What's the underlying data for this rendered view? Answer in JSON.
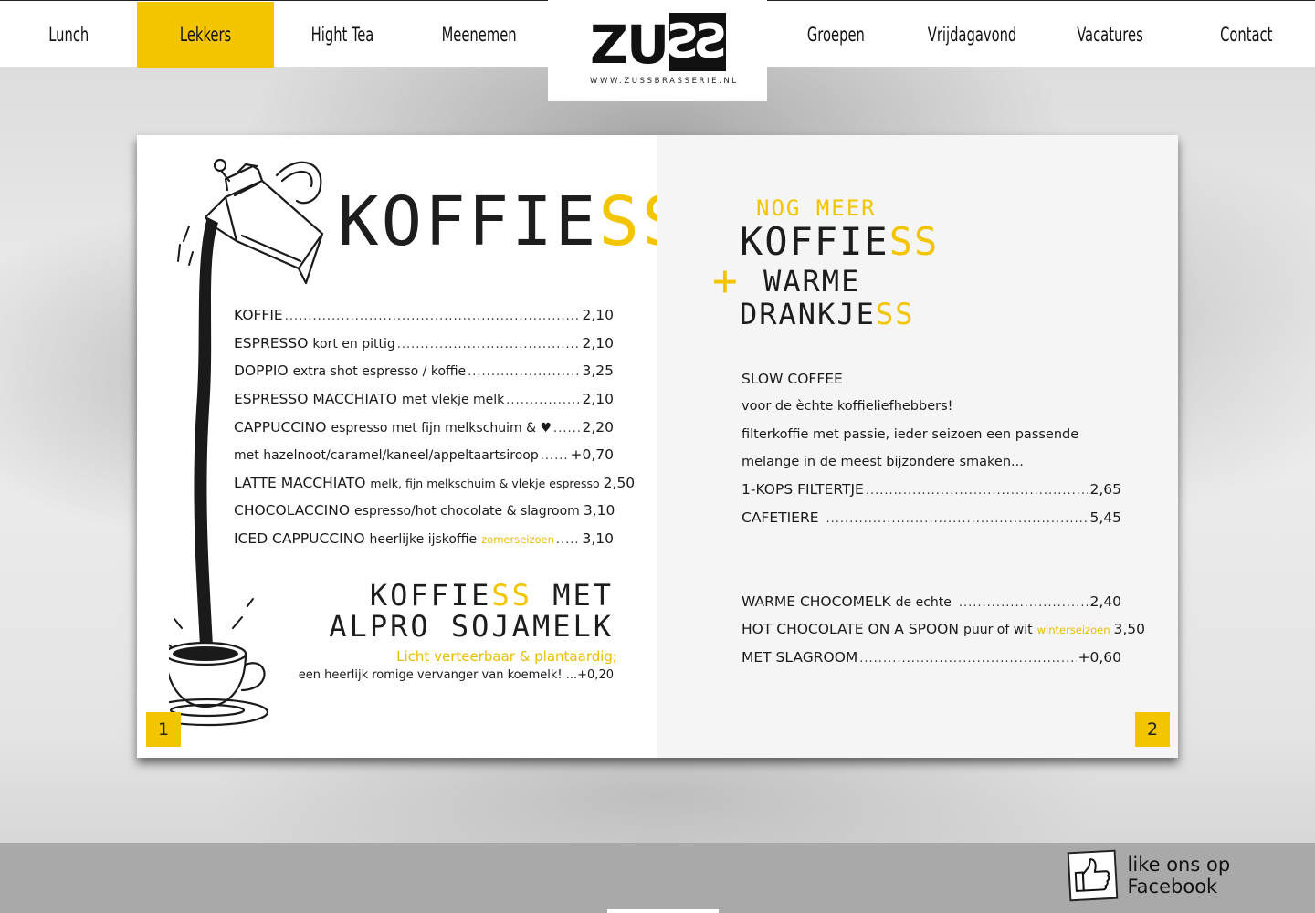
{
  "nav": {
    "items": [
      {
        "label": "Lunch",
        "active": false
      },
      {
        "label": "Lekkers",
        "active": true
      },
      {
        "label": "Hight Tea",
        "active": false
      },
      {
        "label": "Meenemen",
        "active": false
      },
      {
        "label": "Groepen",
        "active": false
      },
      {
        "label": "Vrijdagavond",
        "active": false
      },
      {
        "label": "Vacatures",
        "active": false
      },
      {
        "label": "Contact",
        "active": false
      }
    ],
    "accent_color": "#f2c500"
  },
  "logo": {
    "zu": "ZU",
    "ss": "SS",
    "url": "WWW.ZUSSBRASSERIE.NL"
  },
  "left_page": {
    "title_main": "KOFFIE",
    "title_ss": "SS",
    "items": [
      {
        "name": "KOFFIE",
        "desc": "",
        "note": "",
        "price": "2,10"
      },
      {
        "name": "ESPRESSO",
        "desc": "kort en pittig",
        "note": "",
        "price": "2,10"
      },
      {
        "name": "DOPPIO",
        "desc": "extra shot espresso / koffie",
        "note": "",
        "price": "3,25"
      },
      {
        "name": "ESPRESSO MACCHIATO",
        "desc": "met vlekje melk",
        "note": "",
        "price": "2,10"
      },
      {
        "name": "CAPPUCCINO",
        "desc": "espresso met fijn melkschuim & ♥",
        "note": "",
        "price": "2,20"
      },
      {
        "name": "",
        "desc": "met hazelnoot/caramel/kaneel/appeltaartsiroop",
        "note": "",
        "price": "+0,70"
      },
      {
        "name": "LATTE MACCHIATO",
        "desc": "melk, fijn melkschuim & vlekje espresso",
        "note": "",
        "price": "2,50"
      },
      {
        "name": "CHOCOLACCINO",
        "desc": "espresso/hot chocolate & slagroom",
        "note": "",
        "price": "3,10"
      },
      {
        "name": "ICED CAPPUCCINO",
        "desc": "heerlijke ijskoffie",
        "note": "zomerseizoen",
        "price": "3,10"
      }
    ],
    "alpro_title_1a": "KOFFIE",
    "alpro_title_1ss": "SS",
    "alpro_title_1b": " MET",
    "alpro_title_2": "ALPRO SOJAMELK",
    "alpro_sub": "Licht verteerbaar & plantaardig;",
    "alpro_desc": "een heerlijk romige vervanger van koemelk! ...+0,20",
    "page_number": "1"
  },
  "right_page": {
    "title_pre": "NOG MEER",
    "title_koffie": "KOFFIE",
    "title_ss": "SS",
    "title_plus": "+",
    "title_warme": "WARME",
    "title_drank": "DRANKJE",
    "title_drank_ss": "SS",
    "slow_title": "SLOW COFFEE",
    "slow_lines": [
      "voor de èchte koffieliefhebbers!",
      "filterkoffie met passie, ieder seizoen een passende",
      "melange in de meest bijzondere smaken..."
    ],
    "items": [
      {
        "name": "1-KOPS FILTERTJE",
        "desc": "",
        "note": "",
        "price": "2,65"
      },
      {
        "name": "CAFETIERE",
        "desc": "",
        "note": "",
        "price": "5,45"
      },
      {
        "name": "WARME CHOCOMELK",
        "desc": "de echte",
        "note": "",
        "price": "2,40"
      },
      {
        "name": "HOT CHOCOLATE ON A SPOON",
        "desc": "puur of wit",
        "note": "winterseizoen",
        "price": "3,50"
      },
      {
        "name": "MET SLAGROOM",
        "desc": "",
        "note": "",
        "price": "+0,60"
      }
    ],
    "page_number": "2"
  },
  "footer": {
    "facebook_label": "like ons op Facebook",
    "facebook_icon": "thumbs-up-icon"
  }
}
